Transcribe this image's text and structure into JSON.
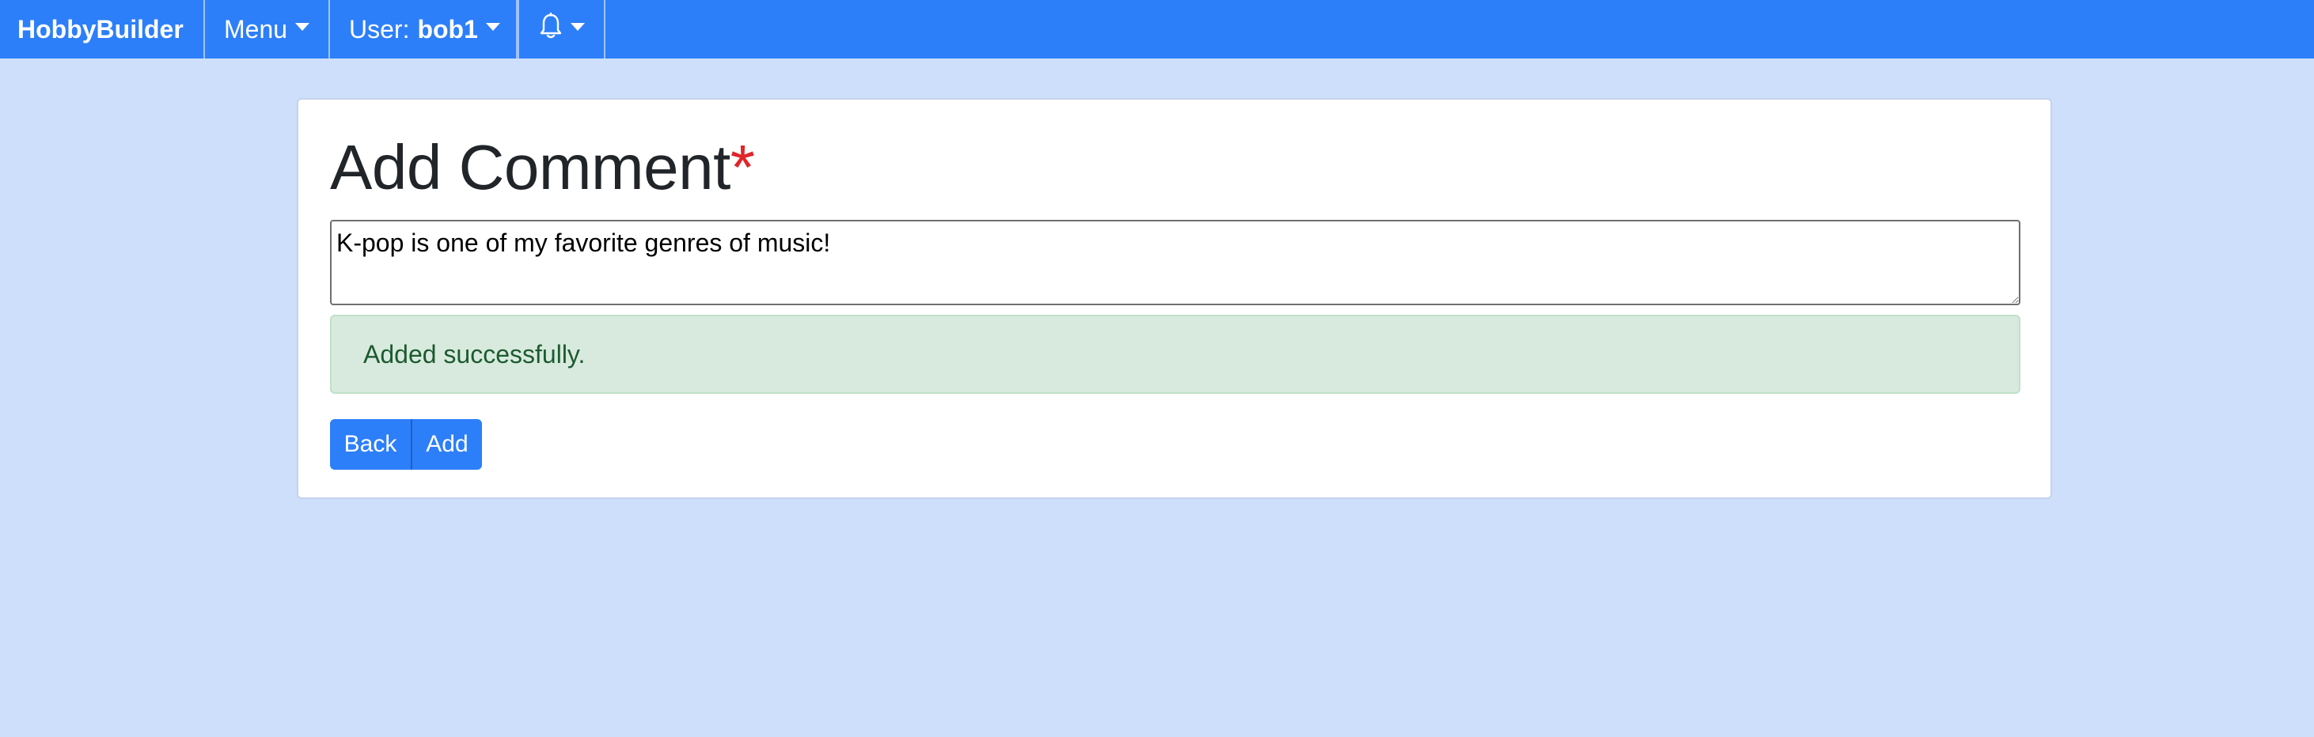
{
  "navbar": {
    "brand": "HobbyBuilder",
    "menu_label": "Menu",
    "user_prefix": "User:",
    "username": "bob1",
    "notifications_icon": "bell-icon"
  },
  "main": {
    "title": "Add Comment",
    "required_marker": "*",
    "comment_value": "K-pop is one of my favorite genres of music!",
    "alert_text": "Added successfully.",
    "back_label": "Back",
    "add_label": "Add"
  },
  "colors": {
    "navbar_bg": "#2d7ff9",
    "page_bg": "#cddffa",
    "required": "#e0262b",
    "alert_bg": "#d8eadd",
    "alert_text": "#1c5a30",
    "button_bg": "#2d7ff9"
  }
}
